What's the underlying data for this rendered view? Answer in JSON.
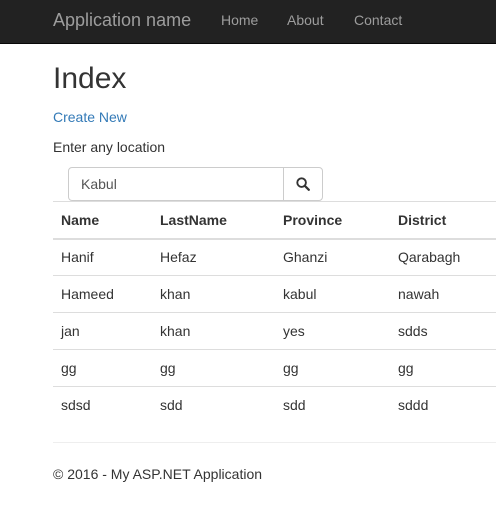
{
  "navbar": {
    "brand": "Application name",
    "links": [
      "Home",
      "About",
      "Contact"
    ]
  },
  "main": {
    "title": "Index",
    "create_link": "Create New",
    "search": {
      "label": "Enter any location",
      "value": "Kabul",
      "icon": "search-icon"
    },
    "table": {
      "headers": [
        "Name",
        "LastName",
        "Province",
        "District"
      ],
      "rows": [
        [
          "Hanif",
          "Hefaz",
          "Ghanzi",
          "Qarabagh"
        ],
        [
          "Hameed",
          "khan",
          "kabul",
          "nawah"
        ],
        [
          "jan",
          "khan",
          "yes",
          "sdds"
        ],
        [
          "gg",
          "gg",
          "gg",
          "gg"
        ],
        [
          "sdsd",
          "sdd",
          "sdd",
          "sddd"
        ]
      ]
    }
  },
  "footer": {
    "text": "© 2016 - My ASP.NET Application"
  },
  "colors": {
    "navbar_bg": "#222222",
    "nav_text": "#9d9d9d",
    "link": "#337ab7",
    "border": "#dddddd"
  }
}
